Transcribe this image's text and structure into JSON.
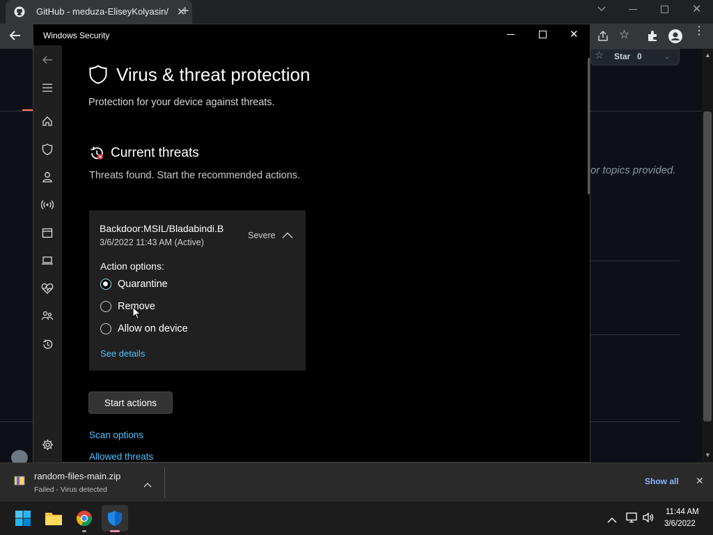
{
  "browser": {
    "tab_title": "GitHub - meduza-EliseyKolyasin/",
    "star_label": "Star",
    "star_count": "0",
    "about_text": "or topics provided."
  },
  "window": {
    "title": "Windows Security"
  },
  "page": {
    "heading": "Virus & threat protection",
    "subtitle": "Protection for your device against threats.",
    "current_threats_heading": "Current threats",
    "current_threats_desc": "Threats found. Start the recommended actions."
  },
  "threat": {
    "name": "Backdoor:MSIL/Bladabindi.B",
    "datetime": "3/6/2022 11:43 AM (Active)",
    "severity": "Severe",
    "action_label": "Action options:",
    "options": [
      {
        "label": "Quarantine",
        "selected": true
      },
      {
        "label": "Remove",
        "selected": false
      },
      {
        "label": "Allow on device",
        "selected": false
      }
    ],
    "see_details": "See details"
  },
  "buttons": {
    "start_actions": "Start actions"
  },
  "links": {
    "scan_options": "Scan options",
    "allowed_threats": "Allowed threats"
  },
  "download": {
    "filename": "random-files-main.zip",
    "status": "Failed - Virus detected",
    "show_all": "Show all"
  },
  "taskbar": {
    "time": "11:44 AM",
    "date": "3/6/2022"
  },
  "colors": {
    "link": "#4cc2ff",
    "window_bg": "#000000",
    "sidebar_bg": "#1f1f1f",
    "card_bg": "#202020"
  }
}
